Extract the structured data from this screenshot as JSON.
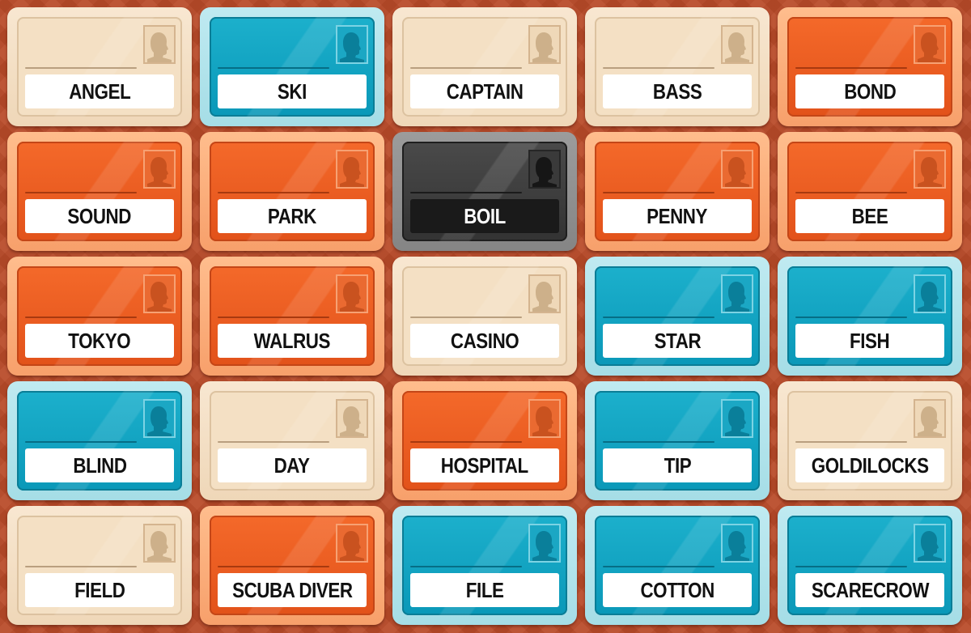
{
  "board": {
    "cards": [
      {
        "word": "ANGEL",
        "team": "neutral"
      },
      {
        "word": "SKI",
        "team": "blue"
      },
      {
        "word": "CAPTAIN",
        "team": "neutral"
      },
      {
        "word": "BASS",
        "team": "neutral"
      },
      {
        "word": "BOND",
        "team": "red"
      },
      {
        "word": "SOUND",
        "team": "red"
      },
      {
        "word": "PARK",
        "team": "red"
      },
      {
        "word": "BOIL",
        "team": "assassin"
      },
      {
        "word": "PENNY",
        "team": "red"
      },
      {
        "word": "BEE",
        "team": "red"
      },
      {
        "word": "TOKYO",
        "team": "red"
      },
      {
        "word": "WALRUS",
        "team": "red"
      },
      {
        "word": "CASINO",
        "team": "neutral"
      },
      {
        "word": "STAR",
        "team": "blue"
      },
      {
        "word": "FISH",
        "team": "blue"
      },
      {
        "word": "BLIND",
        "team": "blue"
      },
      {
        "word": "DAY",
        "team": "neutral"
      },
      {
        "word": "HOSPITAL",
        "team": "red"
      },
      {
        "word": "TIP",
        "team": "blue"
      },
      {
        "word": "GOLDILOCKS",
        "team": "neutral"
      },
      {
        "word": "FIELD",
        "team": "neutral"
      },
      {
        "word": "SCUBA DIVER",
        "team": "red"
      },
      {
        "word": "FILE",
        "team": "blue"
      },
      {
        "word": "COTTON",
        "team": "blue"
      },
      {
        "word": "SCARECROW",
        "team": "blue"
      }
    ]
  },
  "colors": {
    "background": "#b94a28",
    "red_team": "#e85a20",
    "blue_team": "#12a3c2",
    "neutral": "#f4e0c4",
    "assassin": "#3c3c3c"
  },
  "icons": {
    "card_portrait": "person-silhouette-icon"
  }
}
